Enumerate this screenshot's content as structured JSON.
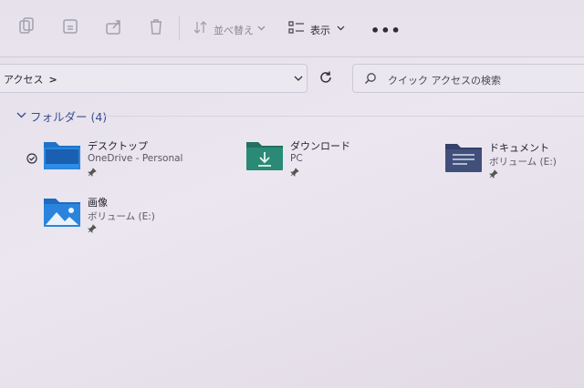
{
  "toolbar": {
    "sort_label": "並べ替え",
    "view_label": "表示",
    "more_label": "•••"
  },
  "address": {
    "path": "アクセス",
    "separator": ">"
  },
  "search": {
    "placeholder": "クイック アクセスの検索"
  },
  "group": {
    "title": "フォルダー (4)"
  },
  "folders": [
    {
      "name": "デスクトップ",
      "location": "OneDrive - Personal",
      "icon": "desktop-folder-icon"
    },
    {
      "name": "ダウンロード",
      "location": "PC",
      "icon": "downloads-folder-icon"
    },
    {
      "name": "ドキュメント",
      "location": "ボリューム (E:)",
      "icon": "documents-folder-icon"
    },
    {
      "name": "画像",
      "location": "ボリューム (E:)",
      "icon": "pictures-folder-icon"
    }
  ],
  "colors": {
    "accent": "#3a4f8f",
    "folder_blue": "#1e73c8",
    "folder_teal": "#2a8a76",
    "folder_navy": "#41507a"
  }
}
